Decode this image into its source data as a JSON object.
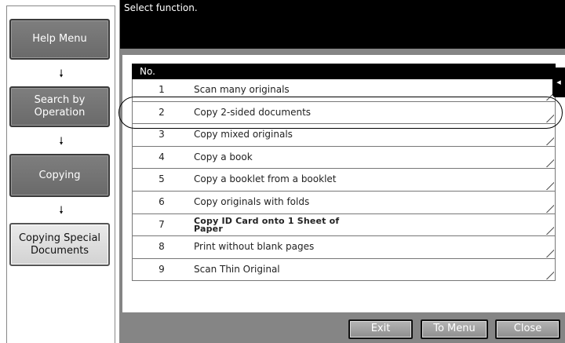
{
  "header": {
    "prompt": "Select function."
  },
  "nav": {
    "items": [
      {
        "label": "Help Menu"
      },
      {
        "label": "Search by Operation"
      },
      {
        "label": "Copying"
      },
      {
        "label": "Copying Special Documents"
      }
    ],
    "arrow": "🠗"
  },
  "table": {
    "column_header": "No.",
    "rows": [
      {
        "num": "1",
        "label": "Scan many originals"
      },
      {
        "num": "2",
        "label": "Copy 2-sided documents"
      },
      {
        "num": "3",
        "label": "Copy mixed originals"
      },
      {
        "num": "4",
        "label": "Copy a book"
      },
      {
        "num": "5",
        "label": "Copy a booklet from a booklet"
      },
      {
        "num": "6",
        "label": "Copy originals with folds"
      },
      {
        "num": "7",
        "label": "Copy ID Card onto 1 Sheet of Paper"
      },
      {
        "num": "8",
        "label": "Print without blank pages"
      },
      {
        "num": "9",
        "label": "Scan Thin Original"
      }
    ]
  },
  "side_tab": {
    "icon": "◂"
  },
  "footer": {
    "exit": "Exit",
    "to_menu": "To Menu",
    "close": "Close"
  }
}
